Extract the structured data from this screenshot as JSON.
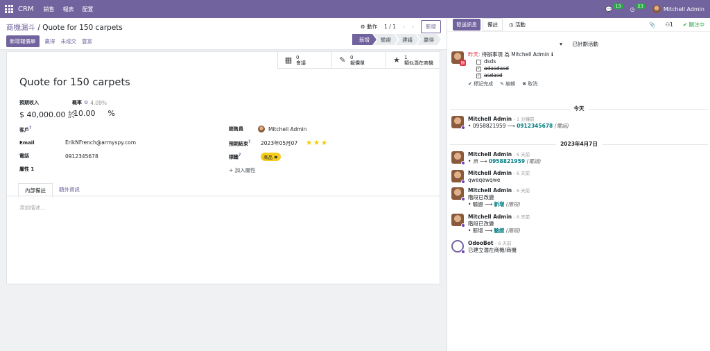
{
  "topbar": {
    "brand": "CRM",
    "menus": [
      "銷售",
      "報表",
      "配置"
    ],
    "messages_count": "13",
    "activities_count": "23",
    "user": "Mitchell Admin"
  },
  "control": {
    "breadcrumb_parent": "商機漏斗",
    "breadcrumb_current": "Quote for 150 carpets",
    "action_label": "動作",
    "pager": "1 / 1",
    "new_label": "新增",
    "buttons": {
      "new_quotation": "新增報價單",
      "won": "贏得",
      "lost": "未成交",
      "enrich": "豐富"
    },
    "stages": [
      "新增",
      "驗證",
      "建議",
      "贏得"
    ]
  },
  "smart_buttons": [
    {
      "count": "0",
      "label": "會議",
      "icon": "calendar-icon"
    },
    {
      "count": "0",
      "label": "報價單",
      "icon": "edit-icon"
    },
    {
      "count": "1",
      "label": "類似潛在商機",
      "icon": "star-icon"
    }
  ],
  "form": {
    "title": "Quote for 150 carpets",
    "expected_revenue_label": "預期收入",
    "probability_label": "概率",
    "probability_auto": "4.09%",
    "expected_revenue": "$ 40,000.00",
    "at_label": "於",
    "probability": "10.00",
    "percent": "%",
    "customer_label": "客戶",
    "email_label": "Email",
    "email": "ErikNFrench@armyspy.com",
    "phone_label": "電話",
    "phone": "0912345678",
    "property_label": "屬性 1",
    "salesperson_label": "銷售員",
    "salesperson": "Mitchell Admin",
    "expected_closing_label": "預期結束",
    "expected_closing": "2023年05月07",
    "tags_label": "標籤",
    "tag": "商品",
    "add_property": "加入屬性",
    "tabs": [
      "內部備註",
      "額外資訊"
    ],
    "description_placeholder": "添加描述..."
  },
  "chatter": {
    "send_message": "發送訊息",
    "log_note": "備註",
    "activities": "活動",
    "followers": "1",
    "following": "關注中",
    "planned_header": "已計劃活動",
    "activity": {
      "when": "昨天:",
      "type": "待辦事項",
      "for": "為 Mitchell Admin",
      "items": [
        {
          "text": "dsds",
          "done": false
        },
        {
          "text": "adasdasd",
          "done": true
        },
        {
          "text": "asdasd",
          "done": true
        }
      ],
      "mark_done": "標記完成",
      "edit": "編輯",
      "cancel": "取消"
    },
    "today": "今天",
    "date_sep": "2023年4月7日",
    "messages": [
      {
        "author": "Mitchell Admin",
        "time": "- 1 分鐘前",
        "old": "0958821959",
        "new": "0912345678",
        "field": "(電話)"
      },
      {
        "author": "Mitchell Admin",
        "time": "- 6 天前",
        "old": "無",
        "new": "0958821959",
        "field": "(電話)"
      },
      {
        "author": "Mitchell Admin",
        "time": "- 6 天前",
        "text": "qweqewqwe"
      },
      {
        "author": "Mitchell Admin",
        "time": "- 6 天前",
        "text": "階段已改變",
        "old": "驗證",
        "new": "新增",
        "field": "(階段)"
      },
      {
        "author": "Mitchell Admin",
        "time": "- 6 天前",
        "text": "階段已改變",
        "old": "新增",
        "new": "驗證",
        "field": "(階段)"
      },
      {
        "author": "OdooBot",
        "time": "- 6 天前",
        "text": "已建立潛在商機/商機"
      }
    ]
  }
}
